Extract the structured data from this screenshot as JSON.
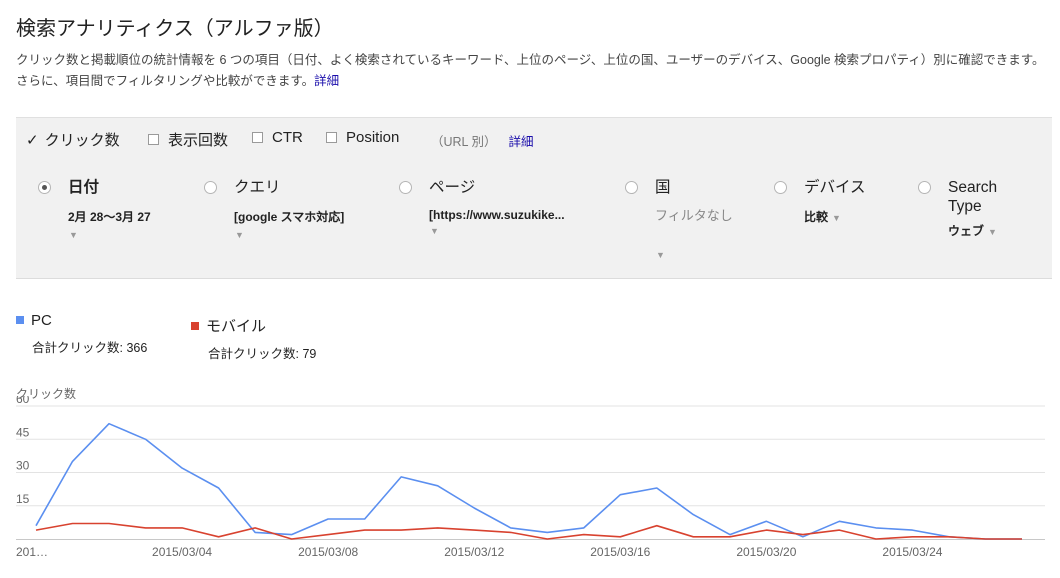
{
  "header": {
    "title": "検索アナリティクス（アルファ版）",
    "description": "クリック数と掲載順位の統計情報を 6 つの項目（日付、よく検索されているキーワード、上位のページ、上位の国、ユーザーのデバイス、Google 検索プロパティ）別に確認できます。さらに、項目間でフィルタリングや比較ができます。",
    "details_link": "詳細"
  },
  "metrics": {
    "clicks": {
      "label": "クリック数",
      "checked": true
    },
    "impressions": {
      "label": "表示回数",
      "checked": false
    },
    "ctr": {
      "label": "CTR",
      "checked": false
    },
    "position": {
      "label": "Position",
      "checked": false
    },
    "url_note": "（URL 別）",
    "details_link": "詳細"
  },
  "dimensions": {
    "date": {
      "label": "日付",
      "value": "2月 28〜3月 27",
      "selected": true
    },
    "query": {
      "label": "クエリ",
      "value": "[google スマホ対応]"
    },
    "page": {
      "label": "ページ",
      "value": "[https://www.suzukike..."
    },
    "country": {
      "label": "国",
      "value": "フィルタなし"
    },
    "device": {
      "label": "デバイス",
      "value": "比較"
    },
    "search_type": {
      "label": "Search Type",
      "value": "ウェブ"
    }
  },
  "legend": {
    "pc": {
      "label": "PC",
      "total": "合計クリック数: 366",
      "color": "#5b8ff0"
    },
    "mobile": {
      "label": "モバイル",
      "total": "合計クリック数: 79",
      "color": "#d8422f"
    }
  },
  "chart_data": {
    "type": "line",
    "ylabel": "クリック数",
    "ylim": [
      0,
      60
    ],
    "yticks": [
      15,
      30,
      45,
      60
    ],
    "x_tick_labels": [
      "201…",
      "2015/03/04",
      "2015/03/08",
      "2015/03/12",
      "2015/03/16",
      "2015/03/20",
      "2015/03/24"
    ],
    "x_tick_index": [
      0,
      4,
      8,
      12,
      16,
      20,
      24
    ],
    "grid": true,
    "series": [
      {
        "name": "PC",
        "color": "#5b8ff0",
        "values": [
          6,
          35,
          52,
          45,
          32,
          23,
          3,
          2,
          9,
          9,
          28,
          24,
          14,
          5,
          3,
          5,
          20,
          23,
          11,
          2,
          8,
          1,
          8,
          5,
          4,
          1,
          0,
          0
        ]
      },
      {
        "name": "モバイル",
        "color": "#d8422f",
        "values": [
          4,
          7,
          7,
          5,
          5,
          1,
          5,
          0,
          2,
          4,
          4,
          5,
          4,
          3,
          0,
          2,
          1,
          6,
          1,
          1,
          4,
          2,
          4,
          0,
          1,
          1,
          0,
          0
        ]
      }
    ]
  }
}
